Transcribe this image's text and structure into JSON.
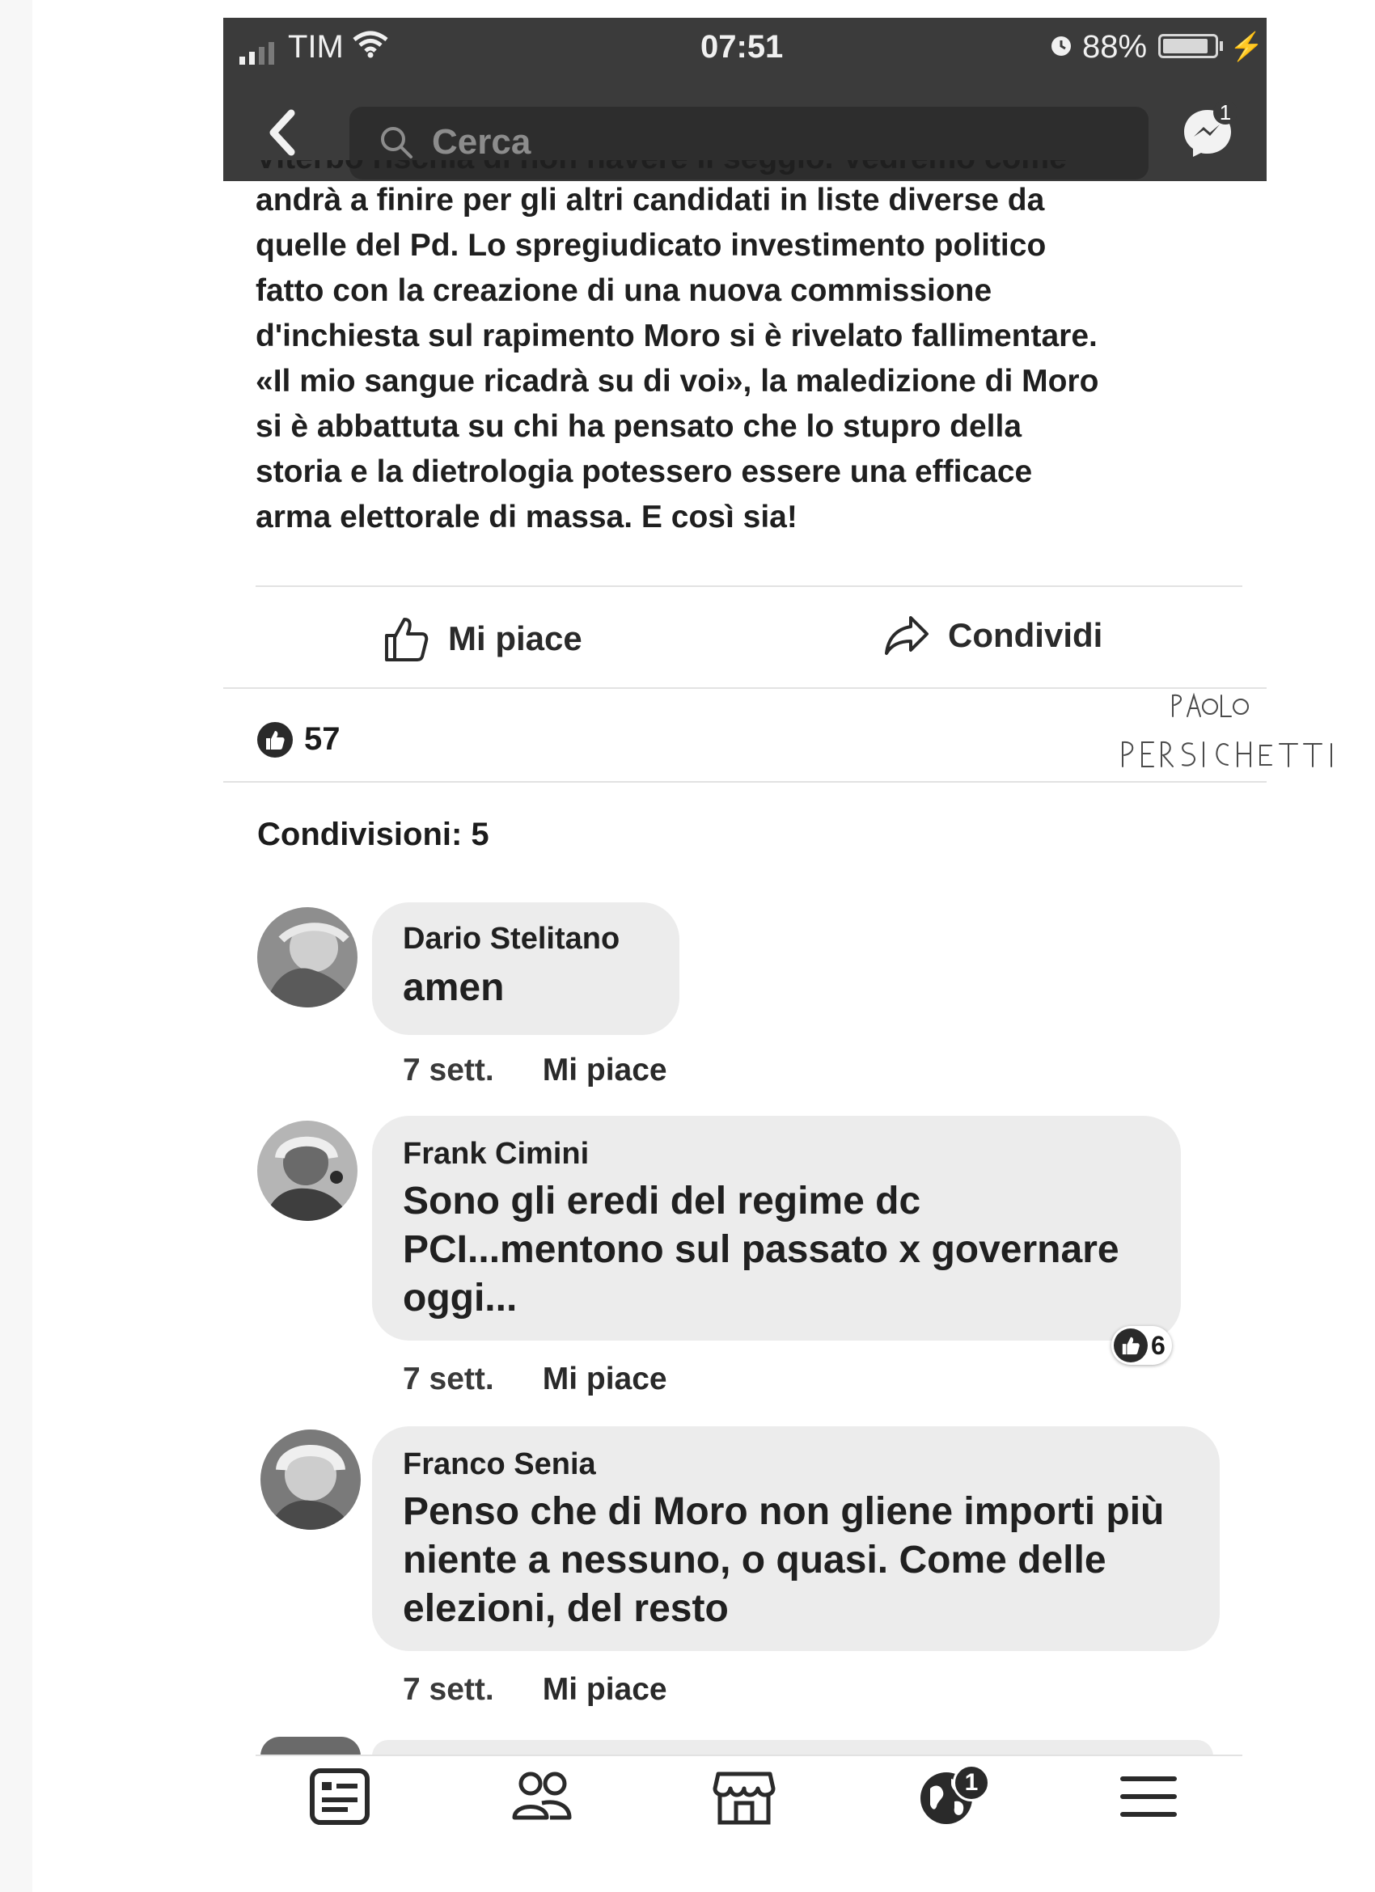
{
  "status_bar": {
    "carrier": "TIM",
    "time": "07:51",
    "battery_pct": "88%",
    "battery_level": 0.88
  },
  "nav": {
    "search_placeholder": "Cerca",
    "messenger_badge": "1"
  },
  "post": {
    "text_cut_line": "Viterbo rischia di non havere il seggio. Vedremo come",
    "text_lines": [
      "andrà a finire per gli altri candidati in liste diverse da",
      "quelle del Pd. Lo spregiudicato investimento politico",
      "fatto con la creazione di una nuova commissione",
      "d'inchiesta sul rapimento Moro si è rivelato fallimentare.",
      "«Il mio sangue ricadrà su di voi», la maledizione di Moro",
      "si è abbattuta su chi ha pensato che lo stupro della",
      "storia e la dietrologia potessero essere una efficace",
      "arma elettorale di massa. E così sia!"
    ],
    "like_label": "Mi piace",
    "share_label": "Condividi",
    "reaction_count": "57",
    "shares_text": "Condivisioni: 5"
  },
  "comments": [
    {
      "name": "Dario Stelitano",
      "text": "amen",
      "time": "7 sett.",
      "like_label": "Mi piace"
    },
    {
      "name": "Frank Cimini",
      "text_lines": [
        "Sono gli eredi del regime dc",
        "PCI...mentono sul passato x governare",
        "oggi..."
      ],
      "time": "7 sett.",
      "like_label": "Mi piace",
      "reactions": "6"
    },
    {
      "name": "Franco Senia",
      "text_lines": [
        "Penso che di Moro non gliene importi più",
        "niente a nessuno, o quasi. Come delle",
        "elezioni, del resto"
      ],
      "time": "7 sett.",
      "like_label": "Mi piace"
    }
  ],
  "tab_bar": {
    "icons": [
      "news-feed-icon",
      "friends-icon",
      "marketplace-icon",
      "notifications-globe-icon",
      "menu-icon"
    ],
    "notifications_badge": "1"
  },
  "signature": {
    "line1": "PAOLO",
    "line2": "PERSICHETTI"
  }
}
